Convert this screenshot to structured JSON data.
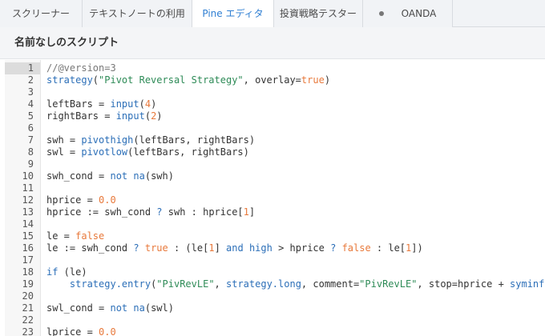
{
  "tabs": [
    {
      "label": "スクリーナー",
      "active": false
    },
    {
      "label": "テキストノートの利用",
      "active": false
    },
    {
      "label": "Pine エディタ",
      "active": true
    },
    {
      "label": "投資戦略テスター",
      "active": false
    },
    {
      "label": "OANDA",
      "active": false
    }
  ],
  "panel": {
    "title": "名前なしのスクリプト"
  },
  "editor": {
    "current_line": 1,
    "lines": [
      {
        "n": "1",
        "tokens": [
          [
            "//@version=3",
            "comment"
          ]
        ]
      },
      {
        "n": "2",
        "tokens": [
          [
            "strategy",
            "func"
          ],
          [
            "(",
            ""
          ],
          [
            "\"Pivot Reversal Strategy\"",
            "string"
          ],
          [
            ", overlay=",
            ""
          ],
          [
            "true",
            "bool"
          ],
          [
            ")",
            ""
          ]
        ]
      },
      {
        "n": "3",
        "tokens": []
      },
      {
        "n": "4",
        "tokens": [
          [
            "leftBars = ",
            ""
          ],
          [
            "input",
            "func"
          ],
          [
            "(",
            ""
          ],
          [
            "4",
            "number"
          ],
          [
            ")",
            ""
          ]
        ]
      },
      {
        "n": "5",
        "tokens": [
          [
            "rightBars = ",
            ""
          ],
          [
            "input",
            "func"
          ],
          [
            "(",
            ""
          ],
          [
            "2",
            "number"
          ],
          [
            ")",
            ""
          ]
        ]
      },
      {
        "n": "6",
        "tokens": []
      },
      {
        "n": "7",
        "tokens": [
          [
            "swh = ",
            ""
          ],
          [
            "pivothigh",
            "func"
          ],
          [
            "(leftBars, rightBars)",
            ""
          ]
        ]
      },
      {
        "n": "8",
        "tokens": [
          [
            "swl = ",
            ""
          ],
          [
            "pivotlow",
            "func"
          ],
          [
            "(leftBars, rightBars)",
            ""
          ]
        ]
      },
      {
        "n": "9",
        "tokens": []
      },
      {
        "n": "10",
        "tokens": [
          [
            "swh_cond = ",
            ""
          ],
          [
            "not",
            "kw"
          ],
          [
            " ",
            ""
          ],
          [
            "na",
            "func"
          ],
          [
            "(swh)",
            ""
          ]
        ]
      },
      {
        "n": "11",
        "tokens": []
      },
      {
        "n": "12",
        "tokens": [
          [
            "hprice = ",
            ""
          ],
          [
            "0.0",
            "number"
          ]
        ]
      },
      {
        "n": "13",
        "tokens": [
          [
            "hprice := swh_cond ",
            ""
          ],
          [
            "?",
            "kw"
          ],
          [
            " swh : hprice[",
            ""
          ],
          [
            "1",
            "number"
          ],
          [
            "]",
            ""
          ]
        ]
      },
      {
        "n": "14",
        "tokens": []
      },
      {
        "n": "15",
        "tokens": [
          [
            "le = ",
            ""
          ],
          [
            "false",
            "bool"
          ]
        ]
      },
      {
        "n": "16",
        "tokens": [
          [
            "le := swh_cond ",
            ""
          ],
          [
            "?",
            "kw"
          ],
          [
            " ",
            ""
          ],
          [
            "true",
            "bool"
          ],
          [
            " : (le[",
            ""
          ],
          [
            "1",
            "number"
          ],
          [
            "] ",
            ""
          ],
          [
            "and",
            "kw"
          ],
          [
            " ",
            ""
          ],
          [
            "high",
            "kw"
          ],
          [
            " > hprice ",
            ""
          ],
          [
            "?",
            "kw"
          ],
          [
            " ",
            ""
          ],
          [
            "false",
            "bool"
          ],
          [
            " : le[",
            ""
          ],
          [
            "1",
            "number"
          ],
          [
            "])",
            ""
          ]
        ]
      },
      {
        "n": "17",
        "tokens": []
      },
      {
        "n": "18",
        "tokens": [
          [
            "if",
            "kw"
          ],
          [
            " (le)",
            ""
          ]
        ]
      },
      {
        "n": "19",
        "tokens": [
          [
            "    ",
            ""
          ],
          [
            "strategy.entry",
            "func"
          ],
          [
            "(",
            ""
          ],
          [
            "\"PivRevLE\"",
            "string"
          ],
          [
            ", ",
            ""
          ],
          [
            "strategy.long",
            "func"
          ],
          [
            ", comment=",
            ""
          ],
          [
            "\"PivRevLE\"",
            "string"
          ],
          [
            ", stop=hprice + ",
            ""
          ],
          [
            "syminfo",
            "func"
          ]
        ]
      },
      {
        "n": "20",
        "tokens": []
      },
      {
        "n": "21",
        "tokens": [
          [
            "swl_cond = ",
            ""
          ],
          [
            "not",
            "kw"
          ],
          [
            " ",
            ""
          ],
          [
            "na",
            "func"
          ],
          [
            "(swl)",
            ""
          ]
        ]
      },
      {
        "n": "22",
        "tokens": []
      },
      {
        "n": "23",
        "tokens": [
          [
            "lprice = ",
            ""
          ],
          [
            "0.0",
            "number"
          ]
        ]
      }
    ]
  }
}
